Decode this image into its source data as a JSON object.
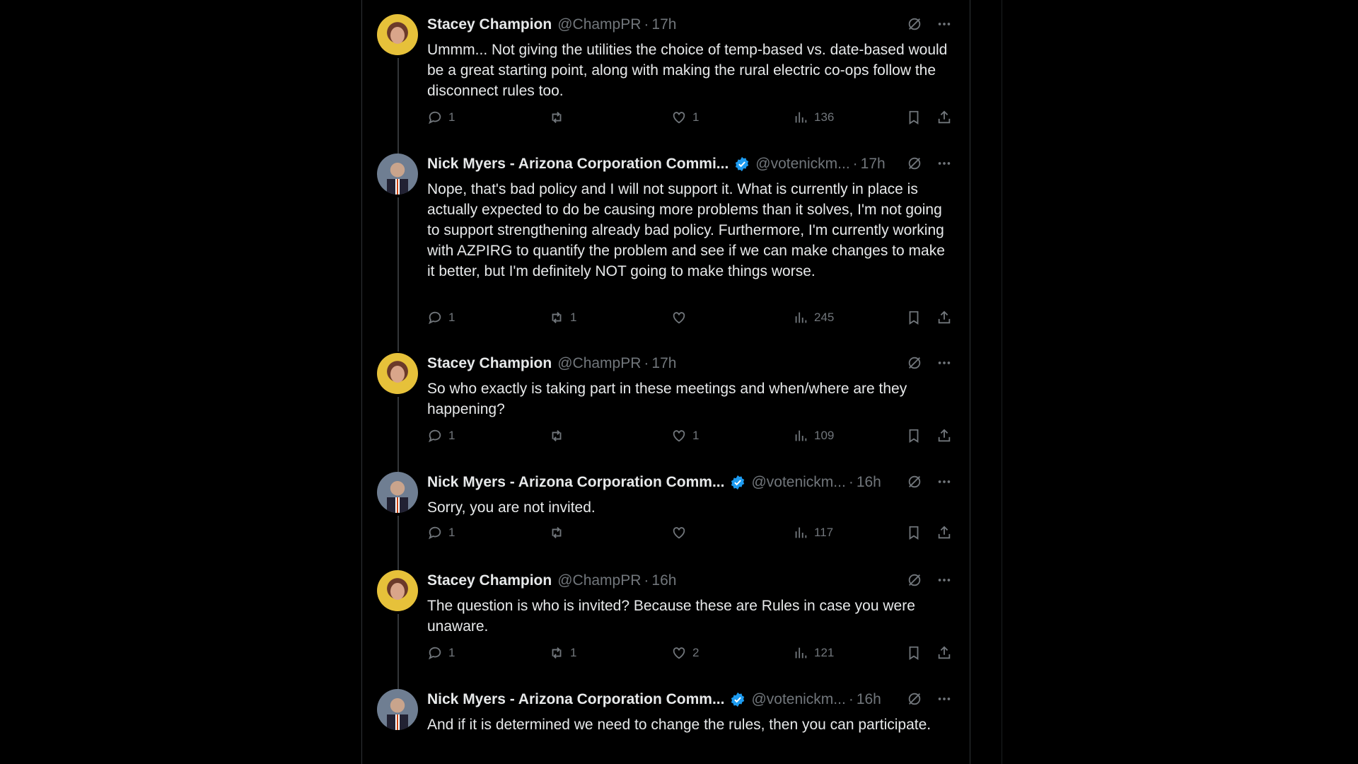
{
  "tweets": [
    {
      "name": "Stacey Champion",
      "handle": "@ChampPR",
      "time": "17h",
      "verified": false,
      "body": "Ummm... Not giving the utilities the choice of temp-based vs. date-based would be a great starting point, along with making the rural electric co-ops follow the disconnect rules too.",
      "replies": "1",
      "retweets": "",
      "likes": "1",
      "views": "136"
    },
    {
      "name": "Nick Myers - Arizona Corporation Commi...",
      "handle": "@votenickm...",
      "time": "17h",
      "verified": true,
      "body": "Nope, that's bad policy and I will not support it.  What is currently in place is actually expected to do be causing more problems than it solves, I'm not going to support strengthening already bad policy. Furthermore, I'm currently working with AZPIRG to quantify the problem and see if we can make changes to make it better, but I'm definitely NOT going to make things worse.",
      "replies": "1",
      "retweets": "1",
      "likes": "",
      "views": "245"
    },
    {
      "name": "Stacey Champion",
      "handle": "@ChampPR",
      "time": "17h",
      "verified": false,
      "body": "So who exactly is taking part in these meetings and when/where are they happening?",
      "replies": "1",
      "retweets": "",
      "likes": "1",
      "views": "109"
    },
    {
      "name": "Nick Myers - Arizona Corporation Comm...",
      "handle": "@votenickm...",
      "time": "16h",
      "verified": true,
      "body": "Sorry, you are not invited.",
      "replies": "1",
      "retweets": "",
      "likes": "",
      "views": "117"
    },
    {
      "name": "Stacey Champion",
      "handle": "@ChampPR",
      "time": "16h",
      "verified": false,
      "body": "The question is who is invited? Because these are Rules in case you were unaware.",
      "replies": "1",
      "retweets": "1",
      "likes": "2",
      "views": "121"
    },
    {
      "name": "Nick Myers - Arizona Corporation Comm...",
      "handle": "@votenickm...",
      "time": "16h",
      "verified": true,
      "body": "And if it is determined we need to change the rules, then you can participate."
    }
  ],
  "separator": "·",
  "icons": {
    "reply": "reply-icon",
    "retweet": "retweet-icon",
    "like": "heart-icon",
    "views": "views-icon",
    "bookmark": "bookmark-icon",
    "share": "share-icon",
    "grok": "grok-icon",
    "more": "more-icon",
    "verified": "verified-badge-icon"
  },
  "colors": {
    "background": "#000000",
    "text": "#e7e9ea",
    "muted": "#71767b",
    "verified": "#1d9bf0"
  }
}
